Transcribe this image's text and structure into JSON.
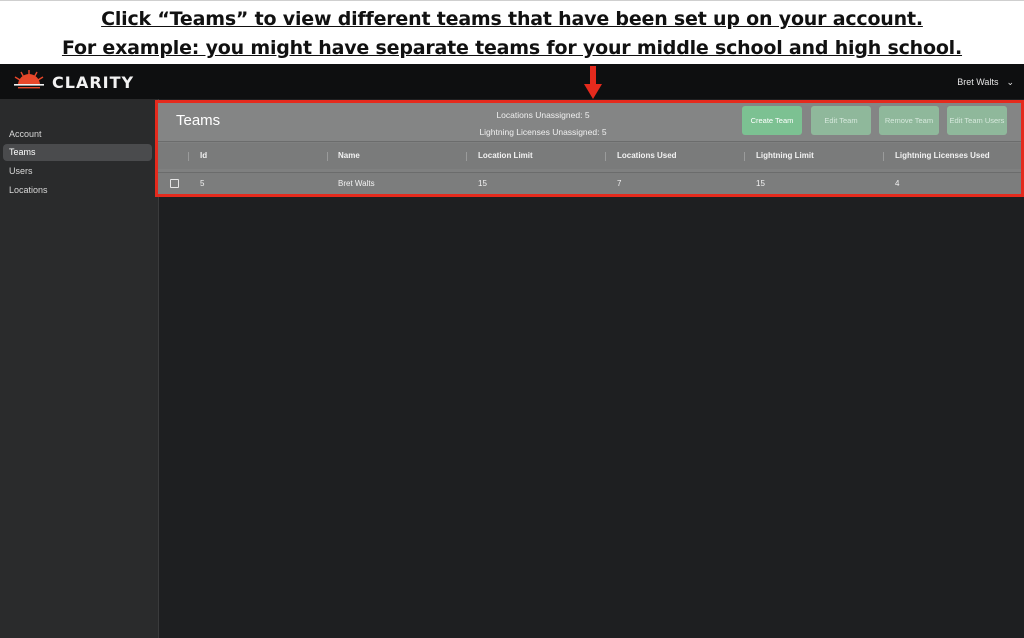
{
  "banner": {
    "line1": "Click “Teams” to view different teams that have been set up on your account.",
    "line2": "For example: you might have separate teams for your middle school and high school."
  },
  "app": {
    "logo_text": "CLARITY",
    "logo_icon": "sunrise-logo-icon",
    "user_name": "Bret Walts",
    "user_menu_icon": "chevron-down-icon"
  },
  "sidebar": {
    "items": [
      {
        "label": "Account",
        "active": false
      },
      {
        "label": "Teams",
        "active": true
      },
      {
        "label": "Users",
        "active": false
      },
      {
        "label": "Locations",
        "active": false
      }
    ]
  },
  "panel": {
    "title": "Teams",
    "locations_unassigned": "Locations Unassigned: 5",
    "lightning_unassigned": "Lightning Licenses Unassigned: 5",
    "buttons": {
      "create": "Create Team",
      "edit": "Edit Team",
      "remove": "Remove Team",
      "edit_users": "Edit Team Users"
    }
  },
  "table": {
    "columns": [
      "Id",
      "Name",
      "Location Limit",
      "Locations Used",
      "Lightning Limit",
      "Lightning Licenses Used"
    ],
    "rows": [
      {
        "id": "5",
        "name": "Bret Walts",
        "location_limit": "15",
        "locations_used": "7",
        "lightning_limit": "15",
        "lightning_used": "4"
      }
    ]
  },
  "colors": {
    "highlight": "#e42a1d",
    "primary_button": "#7cc192",
    "background": "#1e1f21"
  }
}
